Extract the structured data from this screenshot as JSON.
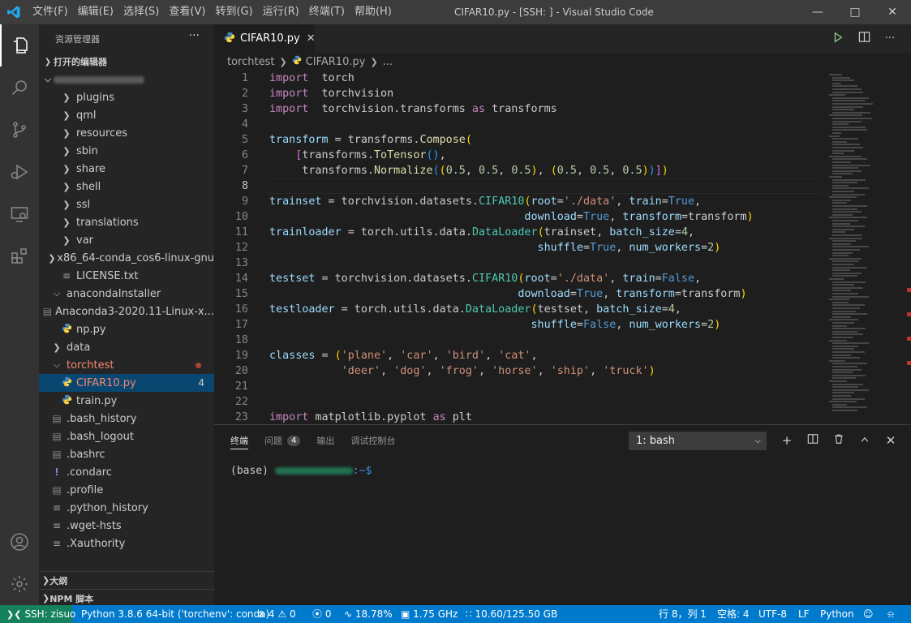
{
  "menu": [
    "文件(F)",
    "编辑(E)",
    "选择(S)",
    "查看(V)",
    "转到(G)",
    "运行(R)",
    "终端(T)",
    "帮助(H)"
  ],
  "window_title": "CIFAR10.py - [SSH: ] - Visual Studio Code",
  "explorer": {
    "header": "资源管理器",
    "more": "···",
    "open_editors": "打开的编辑器",
    "tree": [
      {
        "label": "plugins",
        "kind": "folder",
        "depth": 2,
        "open": false
      },
      {
        "label": "qml",
        "kind": "folder",
        "depth": 2,
        "open": false
      },
      {
        "label": "resources",
        "kind": "folder",
        "depth": 2,
        "open": false
      },
      {
        "label": "sbin",
        "kind": "folder",
        "depth": 2,
        "open": false
      },
      {
        "label": "share",
        "kind": "folder",
        "depth": 2,
        "open": false
      },
      {
        "label": "shell",
        "kind": "folder",
        "depth": 2,
        "open": false
      },
      {
        "label": "ssl",
        "kind": "folder",
        "depth": 2,
        "open": false
      },
      {
        "label": "translations",
        "kind": "folder",
        "depth": 2,
        "open": false
      },
      {
        "label": "var",
        "kind": "folder",
        "depth": 2,
        "open": false
      },
      {
        "label": "x86_64-conda_cos6-linux-gnu",
        "kind": "folder",
        "depth": 2,
        "open": false
      },
      {
        "label": "LICENSE.txt",
        "kind": "text",
        "depth": 2
      },
      {
        "label": "anacondaInstaller",
        "kind": "folder",
        "depth": 1,
        "open": true
      },
      {
        "label": "Anaconda3-2020.11-Linux-x...",
        "kind": "binary",
        "depth": 2
      },
      {
        "label": "np.py",
        "kind": "python",
        "depth": 2
      },
      {
        "label": "data",
        "kind": "folder",
        "depth": 1,
        "open": false
      },
      {
        "label": "torchtest",
        "kind": "folder",
        "depth": 1,
        "open": true,
        "modified": true
      },
      {
        "label": "CIFAR10.py",
        "kind": "python",
        "depth": 2,
        "selected": true,
        "modified": true,
        "badge": "4"
      },
      {
        "label": "train.py",
        "kind": "python",
        "depth": 2
      },
      {
        "label": ".bash_history",
        "kind": "binary",
        "depth": 1
      },
      {
        "label": ".bash_logout",
        "kind": "binary",
        "depth": 1
      },
      {
        "label": ".bashrc",
        "kind": "binary",
        "depth": 1
      },
      {
        "label": ".condarc",
        "kind": "yaml",
        "depth": 1
      },
      {
        "label": ".profile",
        "kind": "binary",
        "depth": 1
      },
      {
        "label": ".python_history",
        "kind": "text",
        "depth": 1
      },
      {
        "label": ".wget-hsts",
        "kind": "text",
        "depth": 1
      },
      {
        "label": ".Xauthority",
        "kind": "text",
        "depth": 1
      }
    ],
    "outline": "大纲",
    "npm": "NPM 脚本"
  },
  "editor": {
    "tab_label": "CIFAR10.py",
    "tab_close": "✕",
    "breadcrumb": [
      "torchtest",
      "CIFAR10.py",
      "..."
    ],
    "current_line": 8,
    "lines": [
      [
        [
          "kw",
          "import"
        ],
        [
          "",
          "  torch"
        ]
      ],
      [
        [
          "kw",
          "import"
        ],
        [
          "",
          "  torchvision"
        ]
      ],
      [
        [
          "kw",
          "import"
        ],
        [
          "",
          "  torchvision.transforms "
        ],
        [
          "kw",
          "as"
        ],
        [
          "",
          " transforms"
        ]
      ],
      [],
      [
        [
          "var",
          "transform"
        ],
        [
          "",
          " = transforms."
        ],
        [
          "fn",
          "Compose"
        ],
        [
          "br1",
          "("
        ]
      ],
      [
        [
          "",
          ""
        ],
        [
          "",
          "    "
        ],
        [
          "br2",
          "["
        ],
        [
          "",
          "transforms."
        ],
        [
          "fn",
          "ToTensor"
        ],
        [
          "br3",
          "()"
        ],
        [
          "",
          ","
        ]
      ],
      [
        [
          "",
          "     transforms."
        ],
        [
          "fn",
          "Normalize"
        ],
        [
          "br3",
          "("
        ],
        [
          "br1",
          "("
        ],
        [
          "num",
          "0.5"
        ],
        [
          "",
          ", "
        ],
        [
          "num",
          "0.5"
        ],
        [
          "",
          ", "
        ],
        [
          "num",
          "0.5"
        ],
        [
          "br1",
          ")"
        ],
        [
          "",
          ", "
        ],
        [
          "br1",
          "("
        ],
        [
          "num",
          "0.5"
        ],
        [
          "",
          ", "
        ],
        [
          "num",
          "0.5"
        ],
        [
          "",
          ", "
        ],
        [
          "num",
          "0.5"
        ],
        [
          "br1",
          ")"
        ],
        [
          "br3",
          ")"
        ],
        [
          "br2",
          "]"
        ],
        [
          "br1",
          ")"
        ]
      ],
      [],
      [
        [
          "var",
          "trainset"
        ],
        [
          "",
          " = torchvision.datasets."
        ],
        [
          "cls",
          "CIFAR10"
        ],
        [
          "br1",
          "("
        ],
        [
          "var",
          "root"
        ],
        [
          "",
          "="
        ],
        [
          "str",
          "'./data'"
        ],
        [
          "",
          ", "
        ],
        [
          "var",
          "train"
        ],
        [
          "",
          "="
        ],
        [
          "bi",
          "True"
        ],
        [
          "",
          ","
        ]
      ],
      [
        [
          "",
          "                                       "
        ],
        [
          "var",
          "download"
        ],
        [
          "",
          "="
        ],
        [
          "bi",
          "True"
        ],
        [
          "",
          ", "
        ],
        [
          "var",
          "transform"
        ],
        [
          "",
          "=transform"
        ],
        [
          "br1",
          ")"
        ]
      ],
      [
        [
          "var",
          "trainloader"
        ],
        [
          "",
          " = torch.utils.data."
        ],
        [
          "cls",
          "DataLoader"
        ],
        [
          "br1",
          "("
        ],
        [
          "",
          "trainset, "
        ],
        [
          "var",
          "batch_size"
        ],
        [
          "",
          "="
        ],
        [
          "num",
          "4"
        ],
        [
          "",
          ","
        ]
      ],
      [
        [
          "",
          "                                         "
        ],
        [
          "var",
          "shuffle"
        ],
        [
          "",
          "="
        ],
        [
          "bi",
          "True"
        ],
        [
          "",
          ", "
        ],
        [
          "var",
          "num_workers"
        ],
        [
          "",
          "="
        ],
        [
          "num",
          "2"
        ],
        [
          "br1",
          ")"
        ]
      ],
      [],
      [
        [
          "var",
          "testset"
        ],
        [
          "",
          " = torchvision.datasets."
        ],
        [
          "cls",
          "CIFAR10"
        ],
        [
          "br1",
          "("
        ],
        [
          "var",
          "root"
        ],
        [
          "",
          "="
        ],
        [
          "str",
          "'./data'"
        ],
        [
          "",
          ", "
        ],
        [
          "var",
          "train"
        ],
        [
          "",
          "="
        ],
        [
          "bi",
          "False"
        ],
        [
          "",
          ","
        ]
      ],
      [
        [
          "",
          "                                      "
        ],
        [
          "var",
          "download"
        ],
        [
          "",
          "="
        ],
        [
          "bi",
          "True"
        ],
        [
          "",
          ", "
        ],
        [
          "var",
          "transform"
        ],
        [
          "",
          "=transform"
        ],
        [
          "br1",
          ")"
        ]
      ],
      [
        [
          "var",
          "testloader"
        ],
        [
          "",
          " = torch.utils.data."
        ],
        [
          "cls",
          "DataLoader"
        ],
        [
          "br1",
          "("
        ],
        [
          "",
          "testset, "
        ],
        [
          "var",
          "batch_size"
        ],
        [
          "",
          "="
        ],
        [
          "num",
          "4"
        ],
        [
          "",
          ","
        ]
      ],
      [
        [
          "",
          "                                        "
        ],
        [
          "var",
          "shuffle"
        ],
        [
          "",
          "="
        ],
        [
          "bi",
          "False"
        ],
        [
          "",
          ", "
        ],
        [
          "var",
          "num_workers"
        ],
        [
          "",
          "="
        ],
        [
          "num",
          "2"
        ],
        [
          "br1",
          ")"
        ]
      ],
      [],
      [
        [
          "var",
          "classes"
        ],
        [
          "",
          " = "
        ],
        [
          "br1",
          "("
        ],
        [
          "str",
          "'plane'"
        ],
        [
          "",
          ", "
        ],
        [
          "str",
          "'car'"
        ],
        [
          "",
          ", "
        ],
        [
          "str",
          "'bird'"
        ],
        [
          "",
          ", "
        ],
        [
          "str",
          "'cat'"
        ],
        [
          "",
          ","
        ]
      ],
      [
        [
          "",
          "           "
        ],
        [
          "str",
          "'deer'"
        ],
        [
          "",
          ", "
        ],
        [
          "str",
          "'dog'"
        ],
        [
          "",
          ", "
        ],
        [
          "str",
          "'frog'"
        ],
        [
          "",
          ", "
        ],
        [
          "str",
          "'horse'"
        ],
        [
          "",
          ", "
        ],
        [
          "str",
          "'ship'"
        ],
        [
          "",
          ", "
        ],
        [
          "str",
          "'truck'"
        ],
        [
          "br1",
          ")"
        ]
      ],
      [],
      [],
      [
        [
          "kw",
          "import"
        ],
        [
          "",
          " matplotlib.pyplot "
        ],
        [
          "kw",
          "as"
        ],
        [
          "",
          " plt"
        ]
      ]
    ]
  },
  "panel": {
    "tabs": [
      "终端",
      "问题",
      "输出",
      "调试控制台"
    ],
    "problems_count": "4",
    "terminal_select": "1: bash",
    "prompt_prefix": "(base) ",
    "prompt_path": ":~$"
  },
  "status": {
    "remote": "SSH: zisuo",
    "python": "Python 3.8.6 64-bit ('torchenv': conda)",
    "errors": "4",
    "warnings": "0",
    "ports": "0",
    "cpu": "18.78%",
    "freq": "1.75 GHz",
    "mem": "10.60/125.50 GB",
    "position": "行 8，列 1",
    "spaces": "空格: 4",
    "encoding": "UTF-8",
    "eol": "LF",
    "language": "Python"
  },
  "colors": {
    "accent": "#007acc",
    "remote": "#16825d",
    "selection": "#094771"
  }
}
